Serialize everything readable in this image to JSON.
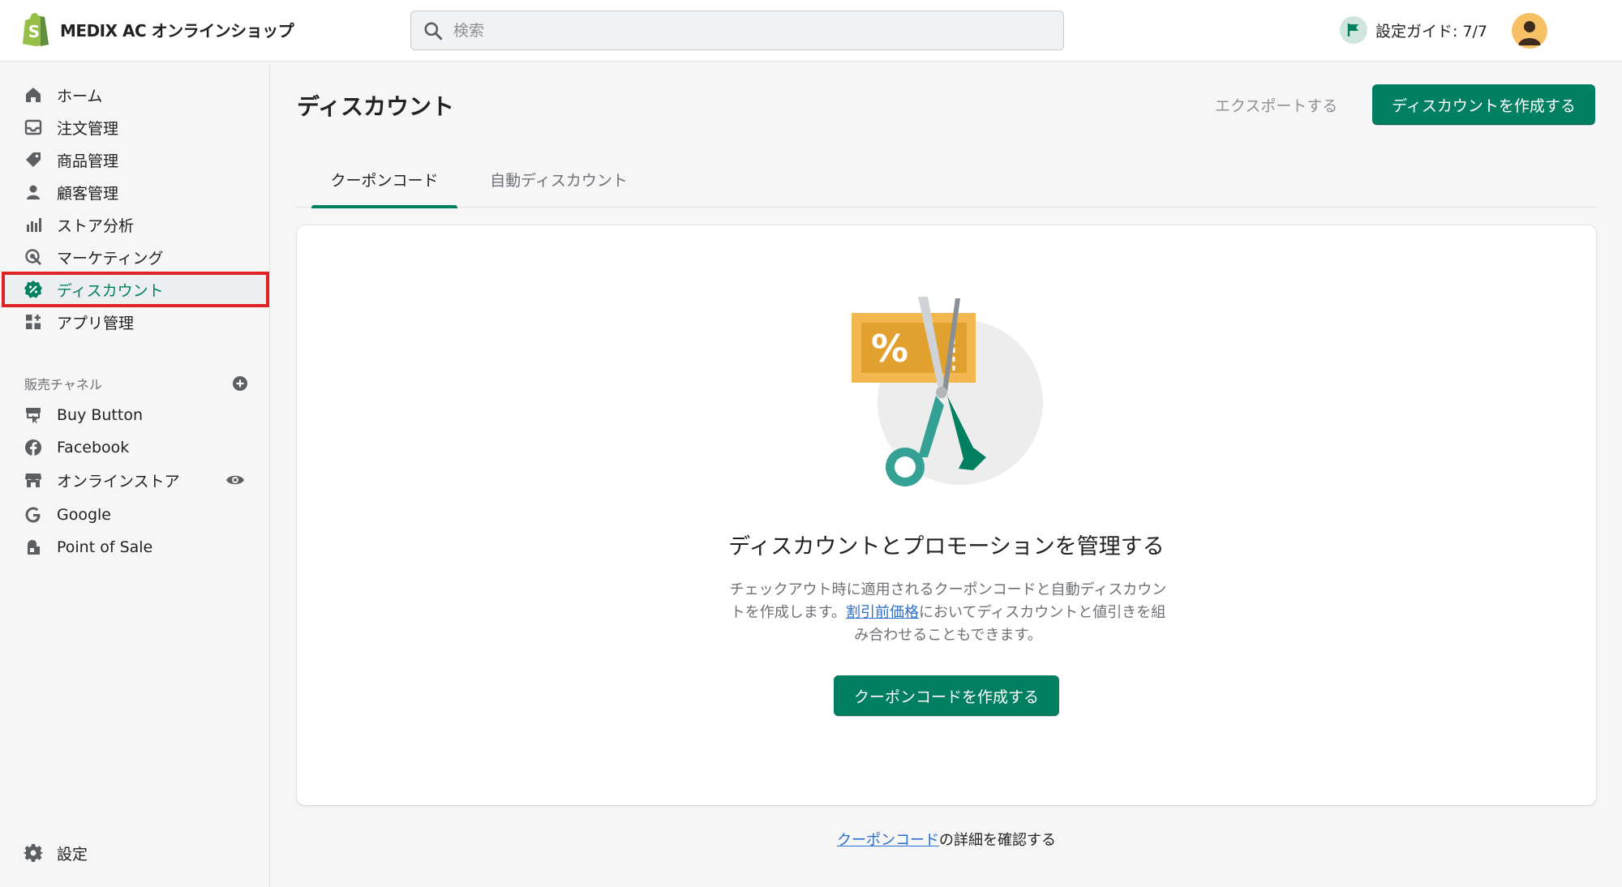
{
  "topbar": {
    "store_name": "MEDIX AC オンラインショップ",
    "search_placeholder": "検索",
    "guide_label": "設定ガイド: 7/7"
  },
  "sidebar": {
    "items": [
      {
        "label": "ホーム",
        "icon": "home-icon"
      },
      {
        "label": "注文管理",
        "icon": "inbox-icon"
      },
      {
        "label": "商品管理",
        "icon": "tag-icon"
      },
      {
        "label": "顧客管理",
        "icon": "person-icon"
      },
      {
        "label": "ストア分析",
        "icon": "bar-chart-icon"
      },
      {
        "label": "マーケティング",
        "icon": "target-icon"
      },
      {
        "label": "ディスカウント",
        "icon": "discount-icon",
        "active": true
      },
      {
        "label": "アプリ管理",
        "icon": "apps-icon"
      }
    ],
    "channels_title": "販売チャネル",
    "channels": [
      {
        "label": "Buy Button",
        "icon": "buy-button-icon"
      },
      {
        "label": "Facebook",
        "icon": "facebook-icon"
      },
      {
        "label": "オンラインストア",
        "icon": "store-icon"
      },
      {
        "label": "Google",
        "icon": "google-icon"
      },
      {
        "label": "Point of Sale",
        "icon": "pos-icon"
      }
    ],
    "settings_label": "設定"
  },
  "main": {
    "title": "ディスカウント",
    "export_label": "エクスポートする",
    "create_label": "ディスカウントを作成する",
    "tabs": [
      {
        "label": "クーポンコード",
        "selected": true
      },
      {
        "label": "自動ディスカウント",
        "selected": false
      }
    ],
    "empty_state": {
      "heading": "ディスカウントとプロモーションを管理する",
      "desc_part1": "チェックアウト時に適用されるクーポンコードと自動ディスカウントを作成します。",
      "desc_link": "割引前価格",
      "desc_part2": "においてディスカウントと値引きを組み合わせることもできます。",
      "button_label": "クーポンコードを作成する"
    },
    "footer_link": "クーポンコード",
    "footer_text": "の詳細を確認する"
  },
  "colors": {
    "primary": "#008060",
    "highlight_border": "#e02424",
    "link": "#2c6ecb"
  }
}
